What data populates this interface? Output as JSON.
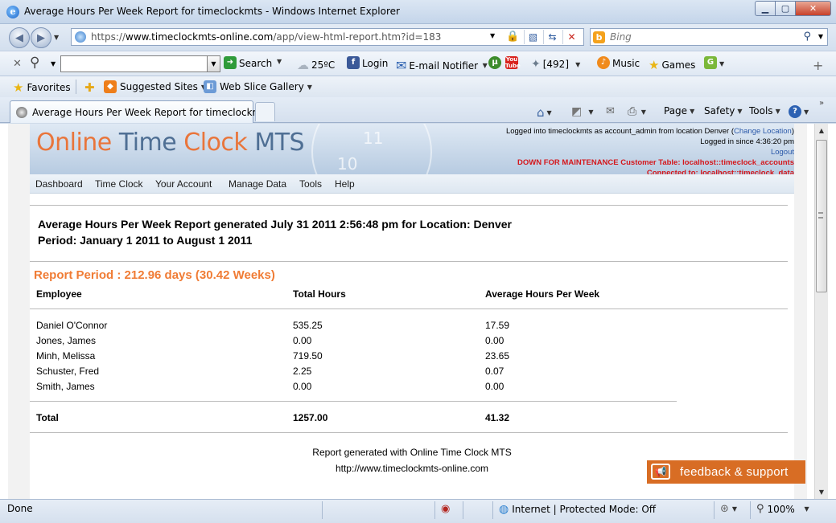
{
  "window": {
    "title": "Average Hours Per Week Report for timeclockmts - Windows Internet Explorer",
    "minimize": "▁",
    "maximize": "▢",
    "close": "✕"
  },
  "address_bar": {
    "url_scheme": "https://",
    "url_host": "www.timeclockmts-online.com",
    "url_path": "/app/view-html-report.htm?id=183",
    "search_placeholder": "Bing"
  },
  "toolbar": {
    "search_label": "Search",
    "weather": "25ºC",
    "login_label": "Login",
    "email_notifier_label": "E-mail Notifier",
    "counter": "[492]",
    "music_label": "Music",
    "games_label": "Games"
  },
  "favorites_bar": {
    "favorites_label": "Favorites",
    "suggested_sites_label": "Suggested Sites",
    "web_slice_label": "Web Slice Gallery"
  },
  "tabs": [
    {
      "label": "Average Hours Per Week Report for timeclockmts"
    }
  ],
  "command_bar": {
    "page_label": "Page",
    "safety_label": "Safety",
    "tools_label": "Tools"
  },
  "site": {
    "logo": {
      "part1": "Online ",
      "part2": "Time ",
      "part3": "Clock ",
      "part4": "MTS"
    },
    "banner_numbers": {
      "eleven": "11",
      "ten": "10"
    },
    "login_info": "Logged into timeclockmts as account_admin from location Denver (",
    "change_location": "Change Location",
    "login_info_end": ")",
    "logged_in_since": "Logged in since 4:36:20 pm",
    "logout": "Logout",
    "maintenance": "DOWN FOR MAINTENANCE Customer Table: localhost::timeclock_accounts",
    "connected": "Connected to: localhost::timeclock_data",
    "menu": [
      "Dashboard",
      "Time Clock",
      "Your Account",
      "Manage Data",
      "Tools",
      "Help"
    ]
  },
  "report": {
    "heading_line1": "Average Hours Per Week Report generated July 31 2011 2:56:48 pm for Location: Denver",
    "heading_line2": "Period: January 1 2011 to August 1 2011",
    "period_summary": "Report Period : 212.96 days (30.42 Weeks)",
    "columns": [
      "Employee",
      "Total Hours",
      "Average Hours Per Week"
    ],
    "rows": [
      [
        "Daniel O'Connor",
        "535.25",
        "17.59"
      ],
      [
        "Jones, James",
        "0.00",
        "0.00"
      ],
      [
        "Minh, Melissa",
        "719.50",
        "23.65"
      ],
      [
        "Schuster, Fred",
        "2.25",
        "0.07"
      ],
      [
        "Smith, James",
        "0.00",
        "0.00"
      ]
    ],
    "total": [
      "Total",
      "1257.00",
      "41.32"
    ],
    "footer_line1": "Report generated with Online Time Clock MTS",
    "footer_line2": "http://www.timeclockmts-online.com"
  },
  "feedback_label": "feedback & support",
  "status_bar": {
    "status": "Done",
    "zone": "Internet | Protected Mode: Off",
    "zoom": "100%"
  }
}
